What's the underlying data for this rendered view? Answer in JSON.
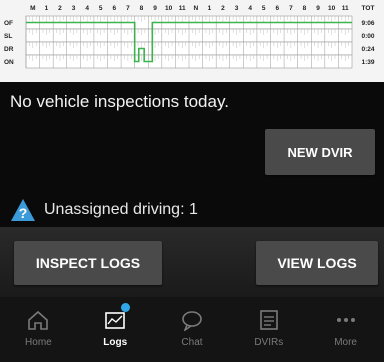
{
  "log_grid": {
    "hours": [
      "M",
      "1",
      "2",
      "3",
      "4",
      "5",
      "6",
      "7",
      "8",
      "9",
      "10",
      "11",
      "N",
      "1",
      "2",
      "3",
      "4",
      "5",
      "6",
      "7",
      "8",
      "9",
      "10",
      "11"
    ],
    "total_label": "TOT",
    "rows": [
      {
        "status": "OF",
        "total": "9:06"
      },
      {
        "status": "SL",
        "total": "0:00"
      },
      {
        "status": "DR",
        "total": "0:24"
      },
      {
        "status": "ON",
        "total": "1:39"
      }
    ]
  },
  "inspections": {
    "message": "No vehicle inspections today."
  },
  "buttons": {
    "new_dvir": "NEW DVIR",
    "inspect_logs": "INSPECT LOGS",
    "view_logs": "VIEW LOGS"
  },
  "unassigned": {
    "text": "Unassigned driving: 1",
    "icon": "question-warning-icon"
  },
  "nav": {
    "items": [
      {
        "label": "Home",
        "icon": "home-icon"
      },
      {
        "label": "Logs",
        "icon": "logs-icon",
        "active": true,
        "badge": true
      },
      {
        "label": "Chat",
        "icon": "chat-icon"
      },
      {
        "label": "DVIRs",
        "icon": "dvir-icon"
      },
      {
        "label": "More",
        "icon": "more-icon"
      }
    ]
  },
  "colors": {
    "accent": "#2fa8e8",
    "graph_line": "#3cb44b",
    "background": "#0a0a0a",
    "button": "#4a4a4a"
  }
}
